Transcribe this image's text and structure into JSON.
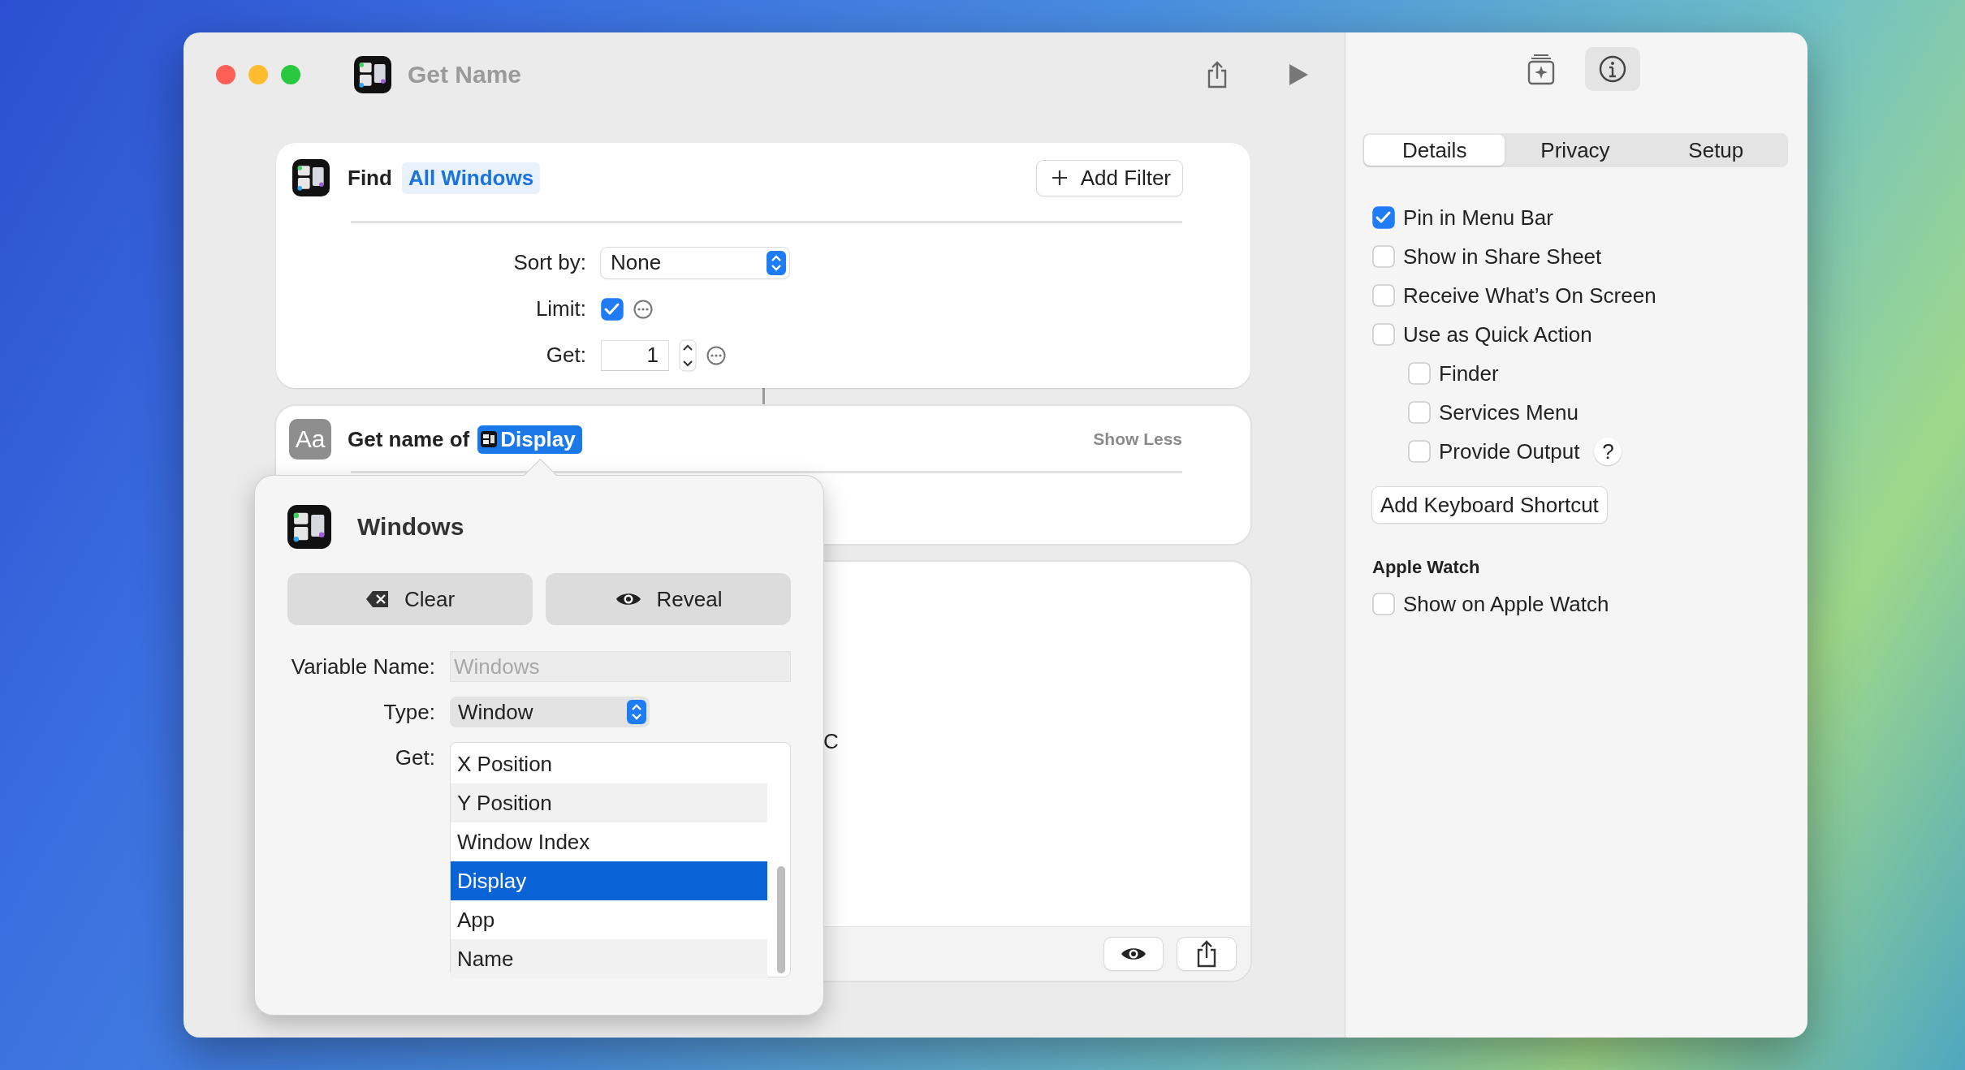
{
  "window": {
    "title": "Get Name"
  },
  "find_action": {
    "label": "Find",
    "source": "All Windows",
    "add_filter": "Add Filter",
    "sort_by": {
      "label": "Sort by:",
      "value": "None"
    },
    "limit": {
      "label": "Limit:",
      "checked": true
    },
    "get": {
      "label": "Get:",
      "value": "1"
    }
  },
  "get_name_action": {
    "icon_text": "Aa",
    "label": "Get name of",
    "variable": "Display",
    "toggle": "Show Less"
  },
  "output_card": {
    "text": "C"
  },
  "popover": {
    "title": "Windows",
    "buttons": [
      {
        "kind": "clear",
        "label": "Clear"
      },
      {
        "kind": "reveal",
        "label": "Reveal"
      }
    ],
    "variable_name": {
      "label": "Variable Name:",
      "placeholder": "Windows"
    },
    "type": {
      "label": "Type:",
      "value": "Window"
    },
    "get": {
      "label": "Get:",
      "items": [
        {
          "label": "X Position",
          "selected": false
        },
        {
          "label": "Y Position",
          "selected": false
        },
        {
          "label": "Window Index",
          "selected": false
        },
        {
          "label": "Display",
          "selected": true
        },
        {
          "label": "App",
          "selected": false
        },
        {
          "label": "Name",
          "selected": false
        }
      ]
    }
  },
  "inspector": {
    "toolbar": [
      {
        "kind": "library",
        "selected": false
      },
      {
        "kind": "info",
        "selected": true
      }
    ],
    "tabs": [
      {
        "label": "Details",
        "selected": true
      },
      {
        "label": "Privacy",
        "selected": false
      },
      {
        "label": "Setup",
        "selected": false
      }
    ],
    "options": [
      {
        "label": "Pin in Menu Bar",
        "checked": true
      },
      {
        "label": "Show in Share Sheet",
        "checked": false
      },
      {
        "label": "Receive What’s On Screen",
        "checked": false
      },
      {
        "label": "Use as Quick Action",
        "checked": false,
        "children": [
          {
            "label": "Finder",
            "checked": false
          },
          {
            "label": "Services Menu",
            "checked": false
          },
          {
            "label": "Provide Output",
            "checked": false,
            "help": "?"
          }
        ]
      }
    ],
    "shortcut_button": "Add Keyboard Shortcut",
    "sections": [
      {
        "heading": "Apple Watch",
        "options": [
          {
            "label": "Show on Apple Watch",
            "checked": false
          }
        ]
      }
    ]
  }
}
